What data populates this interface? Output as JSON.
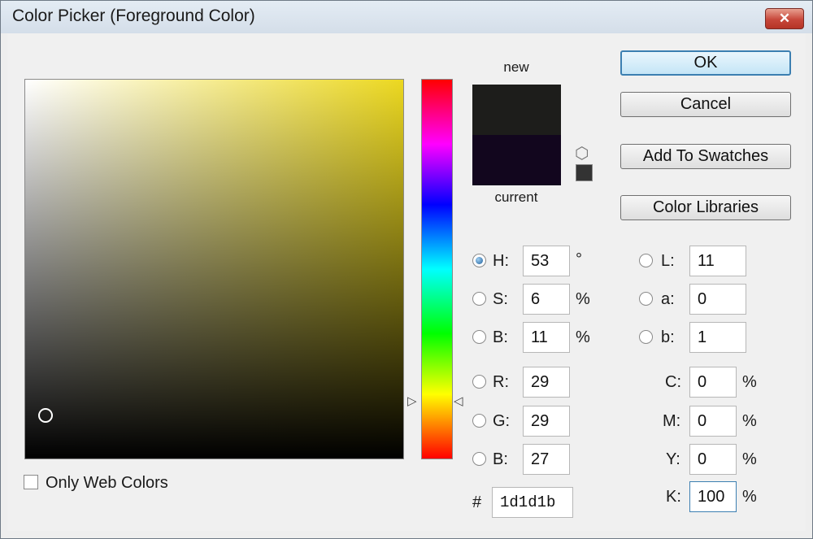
{
  "window": {
    "title": "Color Picker (Foreground Color)",
    "close_icon": "close-icon"
  },
  "picker": {
    "hue_base_color": "#ecd820"
  },
  "swatches": {
    "new_label": "new",
    "current_label": "current",
    "new_color": "#1d1d1b",
    "current_color": "#12061e"
  },
  "buttons": {
    "ok": "OK",
    "cancel": "Cancel",
    "add_to_swatches": "Add To Swatches",
    "color_libraries": "Color Libraries"
  },
  "hsb": [
    {
      "label": "H:",
      "value": "53",
      "unit": "°",
      "checked": true
    },
    {
      "label": "S:",
      "value": "6",
      "unit": "%",
      "checked": false
    },
    {
      "label": "B:",
      "value": "11",
      "unit": "%",
      "checked": false
    }
  ],
  "rgb": [
    {
      "label": "R:",
      "value": "29"
    },
    {
      "label": "G:",
      "value": "29"
    },
    {
      "label": "B:",
      "value": "27"
    }
  ],
  "lab": [
    {
      "label": "L:",
      "value": "11"
    },
    {
      "label": "a:",
      "value": "0"
    },
    {
      "label": "b:",
      "value": "1"
    }
  ],
  "cmyk": [
    {
      "label": "C:",
      "value": "0",
      "unit": "%"
    },
    {
      "label": "M:",
      "value": "0",
      "unit": "%"
    },
    {
      "label": "Y:",
      "value": "0",
      "unit": "%"
    },
    {
      "label": "K:",
      "value": "100",
      "unit": "%"
    }
  ],
  "hex": {
    "label": "#",
    "value": "1d1d1b"
  },
  "only_web_colors": {
    "label": "Only Web Colors",
    "checked": false
  }
}
